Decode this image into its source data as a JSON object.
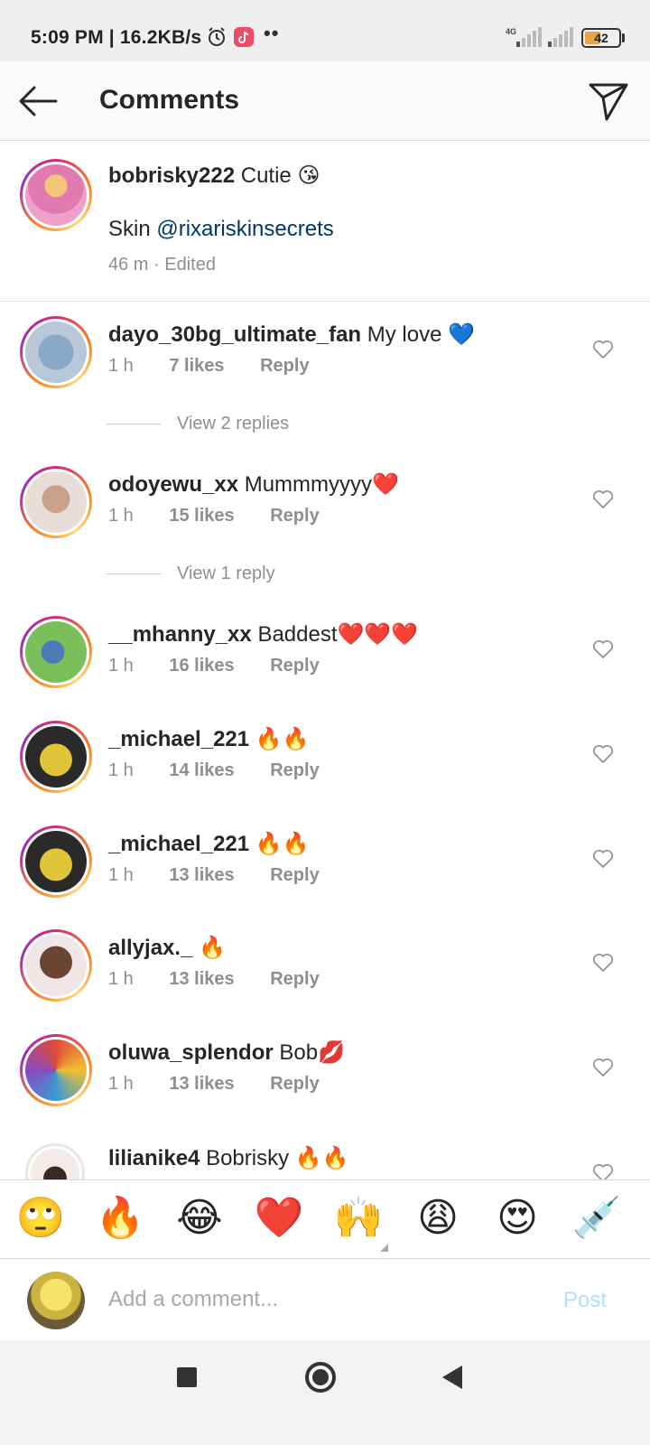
{
  "status_bar": {
    "time": "5:09 PM | 16.2KB/s",
    "network_type": "4G",
    "battery": "42"
  },
  "header": {
    "title": "Comments"
  },
  "caption": {
    "username": "bobrisky222",
    "text": "Cutie 😘",
    "line2_prefix": "Skin ",
    "mention": "@rixariskinsecrets",
    "meta": "46 m · Edited"
  },
  "comments": [
    {
      "username": "dayo_30bg_ultimate_fan",
      "text": "My love 💙",
      "time": "1 h",
      "likes": "7 likes",
      "reply": "Reply",
      "view_replies": "View 2 replies"
    },
    {
      "username": "odoyewu_xx",
      "text": "Mummmyyyy❤️",
      "time": "1 h",
      "likes": "15 likes",
      "reply": "Reply",
      "view_replies": "View 1 reply"
    },
    {
      "username": "__mhanny_xx",
      "text": "Baddest❤️❤️❤️",
      "time": "1 h",
      "likes": "16 likes",
      "reply": "Reply"
    },
    {
      "username": "_michael_221",
      "text": "🔥🔥",
      "time": "1 h",
      "likes": "14 likes",
      "reply": "Reply"
    },
    {
      "username": "_michael_221",
      "text": "🔥🔥",
      "time": "1 h",
      "likes": "13 likes",
      "reply": "Reply"
    },
    {
      "username": "allyjax._",
      "text": "🔥",
      "time": "1 h",
      "likes": "13 likes",
      "reply": "Reply"
    },
    {
      "username": "oluwa_splendor",
      "text": "Bob💋",
      "time": "1 h",
      "likes": "13 likes",
      "reply": "Reply"
    },
    {
      "username": "lilianike4",
      "text": "Bobrisky 🔥🔥"
    }
  ],
  "emoji_bar": [
    "🙄",
    "🔥",
    "😂",
    "❤️",
    "🙌",
    "😩",
    "😍",
    "💉"
  ],
  "input": {
    "placeholder": "Add a comment...",
    "post_label": "Post"
  },
  "colors": {
    "link": "#00376b",
    "meta": "#8e8e8e",
    "post_disabled": "#b2dffc",
    "story_ring": "#d62976"
  }
}
